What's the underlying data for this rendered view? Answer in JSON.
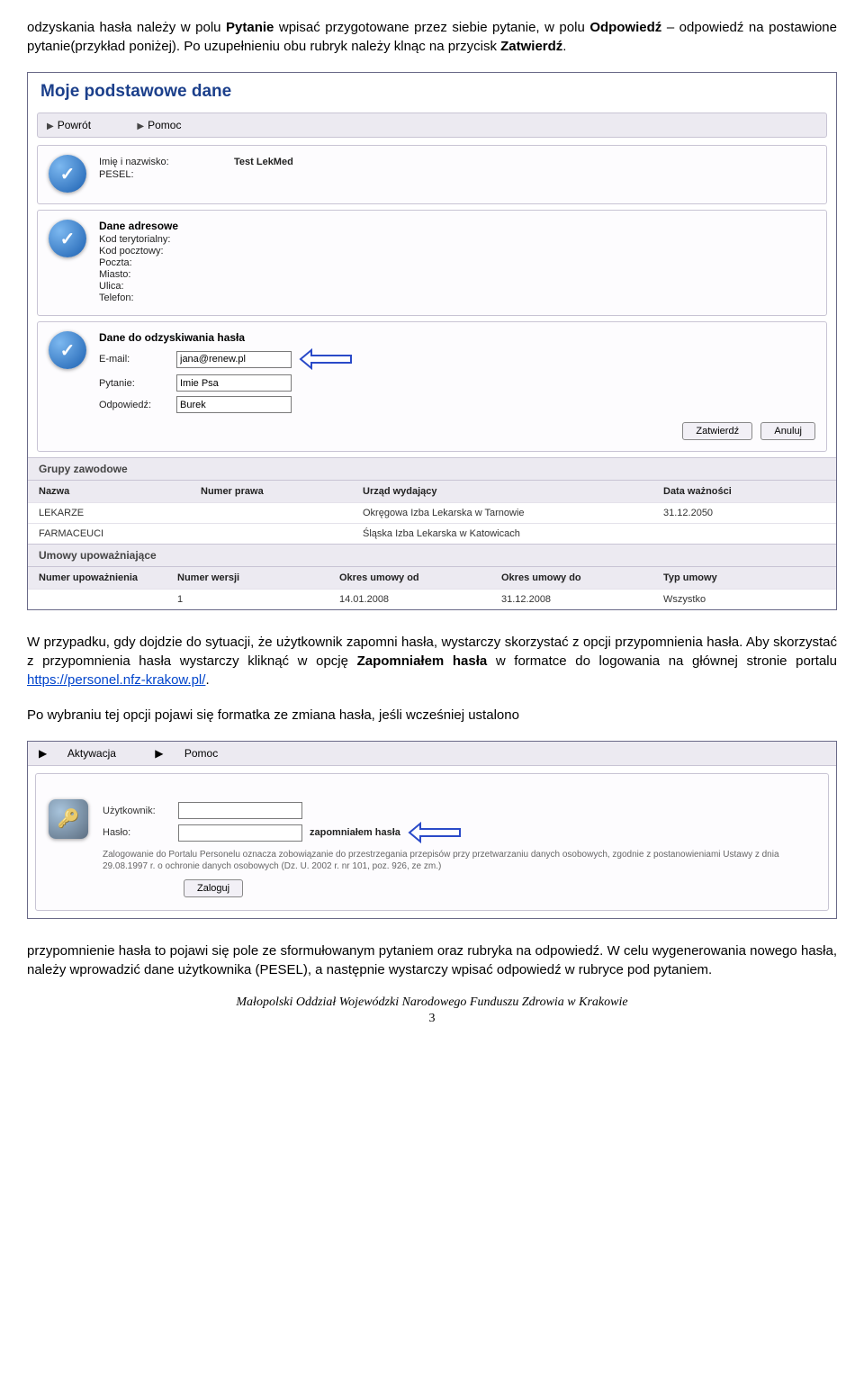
{
  "doc": {
    "intro_para": "odzyskania hasła należy w polu Pytanie wpisać przygotowane przez siebie pytanie, w polu Odpowiedź – odpowiedź na postawione pytanie(przykład poniżej). Po uzupełnieniu obu rubryk należy klnąc na przycisk Zatwierdź.",
    "mid_para1": "W przypadku, gdy dojdzie do sytuacji, że użytkownik zapomni hasła, wystarczy skorzystać z opcji przypomnienia hasła. Aby skorzystać z przypomnienia hasła wystarczy kliknąć w opcję Zapomniałem hasła w formatce do logowania na głównej stronie portalu ",
    "mid_link": "https://personel.nfz-krakow.pl/",
    "mid_para2": "Po wybraniu tej opcji pojawi się formatka ze zmiana hasła, jeśli wcześniej ustalono",
    "end_para": "przypomnienie hasła to pojawi się pole ze sformułowanym pytaniem oraz rubryka na odpowiedź. W celu wygenerowania nowego hasła, należy wprowadzić dane użytkownika (PESEL), a następnie wystarczy wpisać odpowiedź w rubryce pod pytaniem.",
    "footer": "Małopolski Oddział Wojewódzki Narodowego Funduszu Zdrowia w Krakowie",
    "page": "3"
  },
  "panel": {
    "title": "Moje podstawowe dane",
    "toolbar": {
      "back": "Powrót",
      "help": "Pomoc"
    },
    "card1": {
      "name_label": "Imię i nazwisko:",
      "name_value": "Test LekMed",
      "pesel_label": "PESEL:"
    },
    "card2": {
      "title": "Dane adresowe",
      "fields": [
        "Kod terytorialny:",
        "Kod pocztowy:",
        "Poczta:",
        "Miasto:",
        "Ulica:",
        "Telefon:"
      ]
    },
    "card3": {
      "title": "Dane do odzyskiwania hasła",
      "email_label": "E-mail:",
      "email_value": "jana@renew.pl",
      "question_label": "Pytanie:",
      "question_value": "Imie Psa",
      "answer_label": "Odpowiedź:",
      "answer_value": "Burek",
      "confirm": "Zatwierdź",
      "cancel": "Anuluj"
    },
    "groups": {
      "section": "Grupy zawodowe",
      "headers": {
        "name": "Nazwa",
        "num": "Numer prawa",
        "office": "Urząd wydający",
        "date": "Data ważności"
      },
      "rows": [
        {
          "name": "LEKARZE",
          "num": "",
          "office": "Okręgowa Izba Lekarska w Tarnowie",
          "date": "31.12.2050"
        },
        {
          "name": "FARMACEUCI",
          "num": "",
          "office": "Śląska Izba Lekarska w Katowicach",
          "date": ""
        }
      ]
    },
    "contracts": {
      "section": "Umowy upoważniające",
      "headers": {
        "num": "Numer upoważnienia",
        "ver": "Numer wersji",
        "from": "Okres umowy od",
        "to": "Okres umowy do",
        "type": "Typ umowy"
      },
      "row": {
        "num": "",
        "ver": "1",
        "from": "14.01.2008",
        "to": "31.12.2008",
        "type": "Wszystko"
      }
    }
  },
  "login": {
    "toolbar": {
      "activate": "Aktywacja",
      "help": "Pomoc"
    },
    "user_label": "Użytkownik:",
    "pass_label": "Hasło:",
    "forgot": "zapomniałem hasła",
    "legal": "Zalogowanie do Portalu Personelu oznacza zobowiązanie do przestrzegania przepisów przy przetwarzaniu danych osobowych, zgodnie z postanowieniami Ustawy z dnia 29.08.1997 r. o ochronie danych osobowych (Dz. U. 2002 r. nr 101, poz. 926, ze zm.)",
    "login_btn": "Zaloguj"
  }
}
